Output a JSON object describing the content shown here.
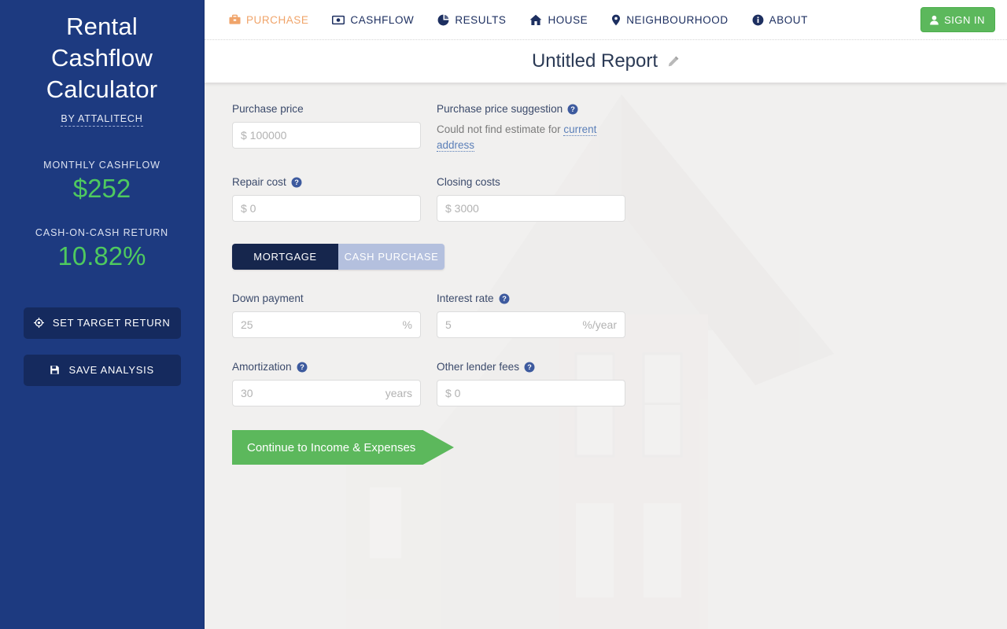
{
  "sidebar": {
    "brand_line1": "Rental",
    "brand_line2": "Cashflow",
    "brand_line3": "Calculator",
    "byline": "BY ATTALITECH",
    "stats": [
      {
        "label": "MONTHLY CASHFLOW",
        "value": "$252"
      },
      {
        "label": "CASH-ON-CASH RETURN",
        "value": "10.82%"
      }
    ],
    "buttons": [
      {
        "label": "SET TARGET RETURN",
        "icon": "crosshair-icon"
      },
      {
        "label": "SAVE ANALYSIS",
        "icon": "floppy-disk-icon"
      }
    ],
    "bg_color": "#1d3a80",
    "accent_green": "#4ec95f"
  },
  "nav": {
    "items": [
      {
        "label": "PURCHASE",
        "icon": "briefcase-icon",
        "active": true
      },
      {
        "label": "CASHFLOW",
        "icon": "money-bill-icon",
        "active": false
      },
      {
        "label": "RESULTS",
        "icon": "pie-chart-icon",
        "active": false
      },
      {
        "label": "HOUSE",
        "icon": "home-icon",
        "active": false
      },
      {
        "label": "NEIGHBOURHOOD",
        "icon": "map-pin-icon",
        "active": false
      },
      {
        "label": "ABOUT",
        "icon": "info-circle-icon",
        "active": false
      }
    ],
    "sign_in_label": "SIGN IN",
    "active_color": "#f0a46a",
    "signin_color": "#5cb85c"
  },
  "report": {
    "title": "Untitled Report",
    "edit_icon": "pencil-icon"
  },
  "form": {
    "purchase_price": {
      "label": "Purchase price",
      "placeholder": "$ 100000",
      "value": ""
    },
    "purchase_price_suggestion": {
      "label": "Purchase price suggestion",
      "note_prefix": "Could not find estimate for ",
      "note_link": "current address"
    },
    "repair_cost": {
      "label": "Repair cost",
      "placeholder": "$ 0",
      "value": ""
    },
    "closing_costs": {
      "label": "Closing costs",
      "placeholder": "$ 3000",
      "value": ""
    },
    "financing_toggle": {
      "mortgage_label": "MORTGAGE",
      "cash_label": "CASH PURCHASE",
      "selected": "MORTGAGE"
    },
    "down_payment": {
      "label": "Down payment",
      "placeholder": "25",
      "value": "",
      "suffix": "%"
    },
    "interest_rate": {
      "label": "Interest rate",
      "placeholder": "5",
      "value": "",
      "suffix": "%/year"
    },
    "amortization": {
      "label": "Amortization",
      "placeholder": "30",
      "value": "",
      "suffix": "years"
    },
    "other_lender_fees": {
      "label": "Other lender fees",
      "placeholder": "$ 0",
      "value": ""
    },
    "continue_label": "Continue to Income & Expenses"
  }
}
